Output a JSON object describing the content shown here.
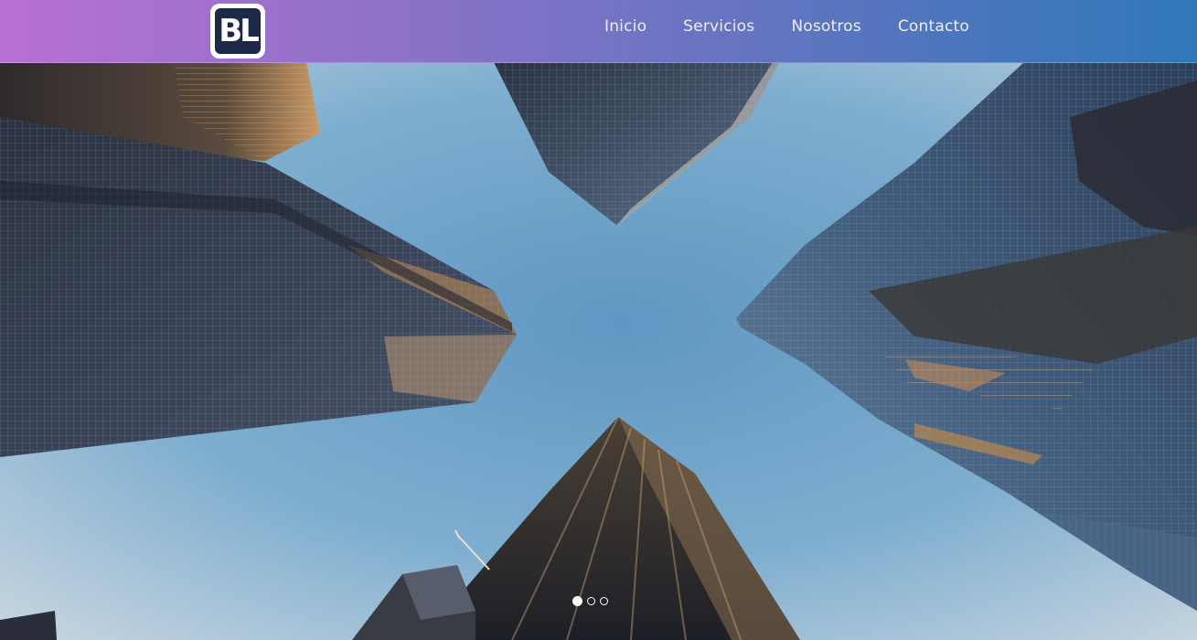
{
  "brand": {
    "logo_text": "BL"
  },
  "nav": {
    "items": [
      {
        "label": "Inicio"
      },
      {
        "label": "Servicios"
      },
      {
        "label": "Nosotros"
      },
      {
        "label": "Contacto"
      }
    ]
  },
  "hero": {
    "image": "skyscrapers-looking-up",
    "slides": [
      {
        "active": true
      },
      {
        "active": false
      },
      {
        "active": false
      }
    ]
  },
  "colors": {
    "nav_gradient_start": "#b86fd6",
    "nav_gradient_end": "#2f78b8",
    "logo_bg": "#1c2a48",
    "sky": "#6fa3c8"
  }
}
